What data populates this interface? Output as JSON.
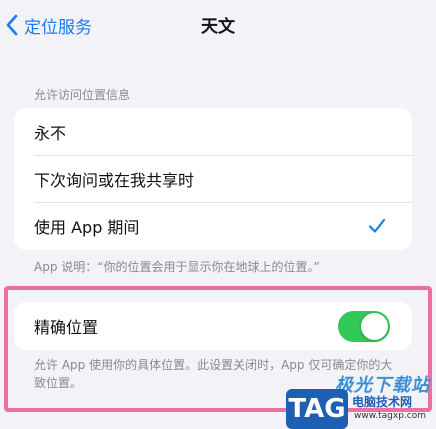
{
  "nav": {
    "back_label": "定位服务",
    "title": "天文"
  },
  "location_access": {
    "header": "允许访问位置信息",
    "options": [
      {
        "label": "永不",
        "selected": false
      },
      {
        "label": "下次询问或在我共享时",
        "selected": false
      },
      {
        "label": "使用 App 期间",
        "selected": true
      }
    ],
    "footnote": "App 说明：“你的位置会用于显示你在地球上的位置。”"
  },
  "precise_location": {
    "label": "精确位置",
    "enabled": true,
    "note": "允许 App 使用你的具体位置。此设置关闭时，App 仅可确定你的大致位置。"
  },
  "colors": {
    "accent": "#1a7cf5",
    "toggle_on": "#34c759",
    "highlight_border": "#ea6fa3",
    "background": "#f2f2f7"
  },
  "icons": {
    "back": "chevron-left-icon",
    "selected": "checkmark-icon"
  },
  "watermark": {
    "brand_cn": "极光下载站",
    "tag": "TAG",
    "sub": "电脑技术网",
    "url": "www.tagxp.com"
  }
}
